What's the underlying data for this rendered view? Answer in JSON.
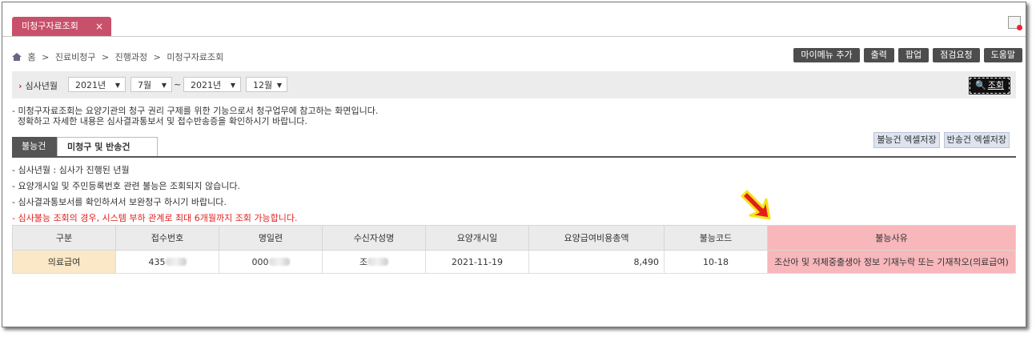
{
  "window_tab": {
    "label": "미청구자료조회",
    "close": "×"
  },
  "breadcrumb": [
    "홈",
    ">",
    "진료비청구",
    ">",
    "진행과정",
    ">",
    "미청구자료조회"
  ],
  "top_buttons": [
    "마이메뉴 추가",
    "출력",
    "팝업",
    "점검요청",
    "도움말"
  ],
  "search": {
    "label": "심사년월",
    "from_year": "2021년",
    "from_month": "7월",
    "tilde": "~",
    "to_year": "2021년",
    "to_month": "12월",
    "query_button": "조회"
  },
  "notice": [
    "- 미청구자료조회는 요양기관의 청구 권리 구제를 위한 기능으로서 청구업무에 참고하는 화면입니다.",
    "  정확하고 자세한 내용은 심사결과통보서 및 접수반송증을 확인하시기 바랍니다."
  ],
  "subtabs": [
    "불능건",
    "미청구 및 반송건"
  ],
  "excel_buttons": [
    "불능건 엑셀저장",
    "반송건 엑셀저장"
  ],
  "bullets": [
    "- 심사년월 : 심사가 진행된 년월",
    "- 요양개시일 및 주민등록번호 관련 불능은 조회되지 않습니다.",
    "- 심사결과통보서를 확인하셔서 보완청구 하시기 바랍니다."
  ],
  "bullet_red": "- 심사불능 조회의 경우, 시스템 부하 관계로 최대 6개월까지 조회 가능합니다.",
  "table": {
    "headers": [
      "구분",
      "접수번호",
      "명일련",
      "수신자성명",
      "요양개시일",
      "요양급여비용총액",
      "불능코드",
      "불능사유"
    ],
    "row": {
      "kind": "의료급여",
      "receipt_no": "435",
      "serial": "000",
      "recipient": "조",
      "start_date": "2021-11-19",
      "total": "8,490",
      "code": "10-18",
      "reason": "조산아 및 저체중출생아 정보 기재누락 또는 기재착오(의료급여)"
    }
  },
  "colors": {
    "tab": "#c9506a",
    "highlight": "#f7b7bb",
    "red_text": "#e02020",
    "arrow_fill": "#e51c1c",
    "arrow_outline": "#f3e516"
  }
}
